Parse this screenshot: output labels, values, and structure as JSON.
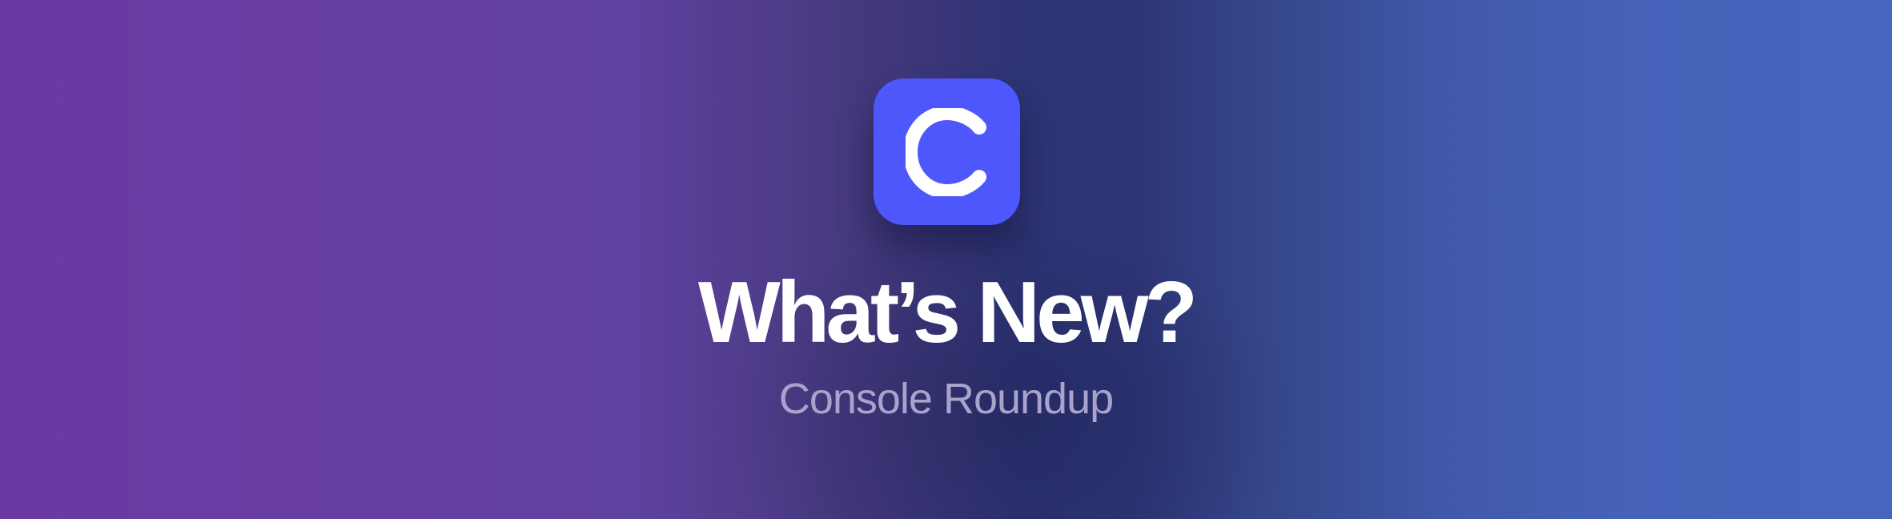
{
  "banner": {
    "logo_icon": "c-logo-icon",
    "title": "What’s New?",
    "subtitle": "Console Roundup"
  },
  "colors": {
    "logo_background": "#4d57fb",
    "title_text": "#ffffff",
    "subtitle_text": "#a9a3cc",
    "gradient_left": "#6a3aa2",
    "gradient_center": "#2e3474",
    "gradient_right": "#4766bd"
  }
}
